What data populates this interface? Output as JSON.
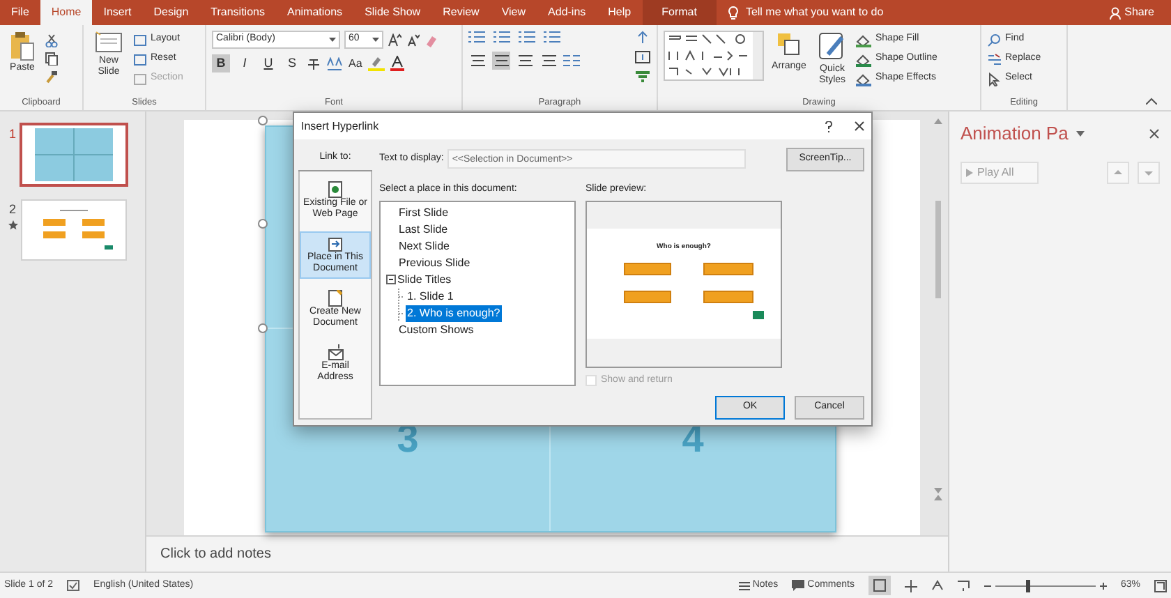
{
  "ribbon_tabs": [
    {
      "label": "File",
      "selected": false,
      "kind": "normal"
    },
    {
      "label": "Home",
      "selected": true,
      "kind": "normal"
    },
    {
      "label": "Insert",
      "selected": false,
      "kind": "normal"
    },
    {
      "label": "Design",
      "selected": false,
      "kind": "normal"
    },
    {
      "label": "Transitions",
      "selected": false,
      "kind": "normal"
    },
    {
      "label": "Animations",
      "selected": false,
      "kind": "normal"
    },
    {
      "label": "Slide Show",
      "selected": false,
      "kind": "normal"
    },
    {
      "label": "Review",
      "selected": false,
      "kind": "normal"
    },
    {
      "label": "View",
      "selected": false,
      "kind": "normal"
    },
    {
      "label": "Add-ins",
      "selected": false,
      "kind": "normal"
    },
    {
      "label": "Help",
      "selected": false,
      "kind": "normal"
    },
    {
      "label": "Format",
      "selected": false,
      "kind": "contextual"
    }
  ],
  "tell_me": {
    "placeholder": "Tell me what you want to do"
  },
  "share": "Share",
  "ribbon_groups": [
    {
      "kind": "clipboard",
      "label": "Clipboard",
      "large": [
        "Paste"
      ]
    },
    {
      "kind": "slides",
      "label": "Slides",
      "large": [
        "New Slide"
      ],
      "small": [
        {
          "label": "Layout",
          "disabled": false
        },
        {
          "label": "Reset",
          "disabled": false
        },
        {
          "label": "Section",
          "disabled": true
        }
      ]
    },
    {
      "kind": "font",
      "label": "Font",
      "font_name": "Calibri (Body)",
      "font_size": "60",
      "format_buttons": [
        {
          "label": "B",
          "selected": true
        },
        {
          "label": "I",
          "selected": false
        },
        {
          "label": "U",
          "selected": false
        },
        {
          "label": "S",
          "selected": false
        }
      ],
      "case_button": "Aa"
    },
    {
      "kind": "paragraph",
      "label": "Paragraph",
      "align": [
        {
          "selected": false
        },
        {
          "selected": true
        },
        {
          "selected": false
        },
        {
          "selected": false
        }
      ]
    },
    {
      "kind": "drawing",
      "label": "Drawing",
      "large": [
        "Arrange",
        "Quick Styles"
      ],
      "small": [
        {
          "label": "Shape Fill",
          "disabled": false
        },
        {
          "label": "Shape Outline",
          "disabled": false
        },
        {
          "label": "Shape Effects",
          "disabled": false
        }
      ]
    },
    {
      "kind": "editing",
      "label": "Editing",
      "small": [
        {
          "label": "Find",
          "disabled": false
        },
        {
          "label": "Replace",
          "disabled": false
        },
        {
          "label": "Select",
          "disabled": false
        }
      ]
    }
  ],
  "thumbnails": [
    {
      "number": "1",
      "selected": true,
      "kind": "grid",
      "animated": false
    },
    {
      "number": "2",
      "selected": false,
      "kind": "menu",
      "animated": true
    }
  ],
  "slide": {
    "bottom_cells": [
      "3",
      "4"
    ]
  },
  "notes": {
    "placeholder": "Click to add notes"
  },
  "animation_pane": {
    "title": "Animation Pa",
    "play_button": "Play All"
  },
  "dialog": {
    "title": "Insert Hyperlink",
    "link_to_label": "Link to:",
    "link_options": [
      {
        "label": "Existing File or Web Page",
        "selected": false
      },
      {
        "label": "Place in This Document",
        "selected": true
      },
      {
        "label": "Create New Document",
        "selected": false
      },
      {
        "label": "E-mail Address",
        "selected": false
      }
    ],
    "text_to_display_label": "Text to display:",
    "text_to_display": "<<Selection in Document>>",
    "screentip_button": "ScreenTip...",
    "place_label": "Select a place in this document:",
    "places": [
      {
        "label": "First Slide",
        "selected": false
      },
      {
        "label": "Last Slide",
        "selected": false
      },
      {
        "label": "Next Slide",
        "selected": false
      },
      {
        "label": "Previous Slide",
        "selected": false
      },
      {
        "label": "Slide Titles",
        "selected": false,
        "expanded": true,
        "children": [
          {
            "label": "1. Slide 1",
            "selected": false
          },
          {
            "label": "2. Who is enough?",
            "selected": true
          }
        ]
      },
      {
        "label": "Custom Shows",
        "selected": false
      }
    ],
    "preview_label": "Slide preview:",
    "preview_title": "Who is enough?",
    "show_and_return": {
      "label": "Show and return",
      "checked": false,
      "disabled": true
    },
    "buttons": [
      "OK",
      "Cancel"
    ]
  },
  "status_bar": {
    "slide": "Slide 1 of 2",
    "language": "English (United States)",
    "notes": "Notes",
    "comments": "Comments",
    "zoom": {
      "level": 0.3
    },
    "zoom_reading": "63%"
  }
}
